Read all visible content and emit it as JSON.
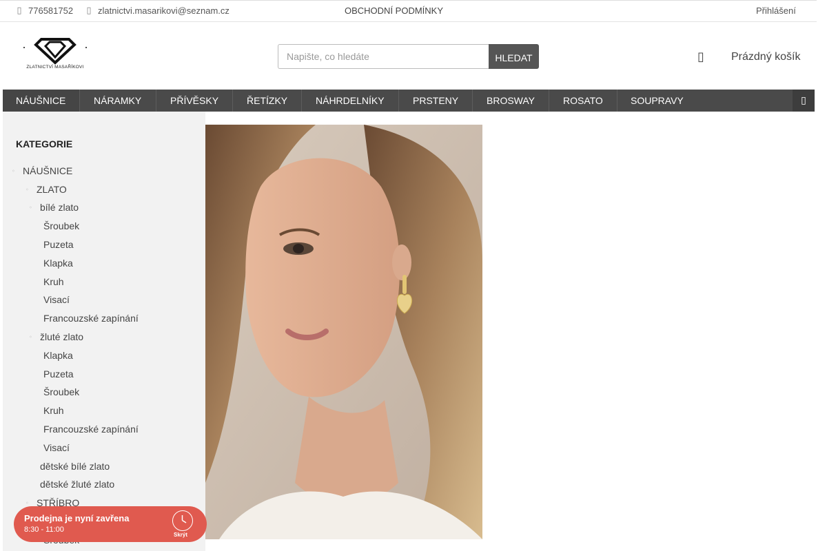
{
  "topbar": {
    "phone_icon": "phone-icon",
    "phone": "776581752",
    "email_icon": "email-icon",
    "email": "zlatnictvi.masarikovi@seznam.cz",
    "terms": "OBCHODNÍ PODMÍNKY",
    "login": "Přihlášení"
  },
  "header": {
    "logo_text": "ZLATNICTVÍ MASAŘÍKOVI",
    "search_placeholder": "Napište, co hledáte",
    "search_button": "HLEDAT",
    "cart_icon": "cart-icon",
    "cart_label": "Prázdný košík"
  },
  "nav": {
    "items": [
      "NÁUŠNICE",
      "NÁRAMKY",
      "PŘÍVĚSKY",
      "ŘETÍZKY",
      "NÁHRDELNÍKY",
      "PRSTENY",
      "BROSWAY",
      "ROSATO",
      "SOUPRAVY"
    ],
    "more_icon": "more-icon"
  },
  "sidebar": {
    "title": "KATEGORIE",
    "categories": [
      "NÁUŠNICE",
      "ZLATO",
      "bílé zlato",
      "Šroubek",
      "Puzeta",
      "Klapka",
      "Kruh",
      "Visací",
      "Francouzské zapínání",
      "žluté zlato",
      "Klapka",
      "Puzeta",
      "Šroubek",
      "Kruh",
      "Francouzské zapínání",
      "Visací",
      "dětské bílé zlato",
      "dětské žluté zlato",
      "STŘÍBRO",
      "Šroubek"
    ]
  },
  "hours_widget": {
    "status": "Prodejna je nyní zavřena",
    "time": "8:30 - 11:00",
    "clock_icon": "clock-icon",
    "hide": "Skrýt"
  },
  "colors": {
    "nav_bg": "#4a4a4a",
    "sidebar_bg": "#f2f2f2",
    "widget_bg": "#e05a4f",
    "search_button_bg": "#555555"
  }
}
